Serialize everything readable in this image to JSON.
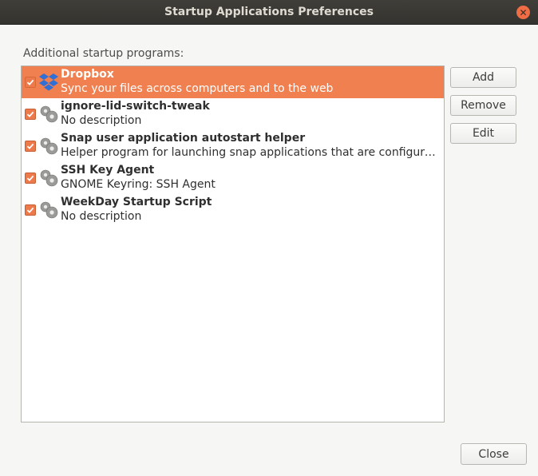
{
  "window": {
    "title": "Startup Applications Preferences"
  },
  "list_label": "Additional startup programs:",
  "programs": [
    {
      "name": "Dropbox",
      "description": "Sync your files across computers and to the web",
      "checked": true,
      "icon": "dropbox-icon",
      "selected": true
    },
    {
      "name": "ignore-lid-switch-tweak",
      "description": "No description",
      "checked": true,
      "icon": "gears-icon"
    },
    {
      "name": "Snap user application autostart helper",
      "description": "Helper program for launching snap applications that are configured t…",
      "checked": true,
      "icon": "gears-icon"
    },
    {
      "name": "SSH Key Agent",
      "description": "GNOME Keyring: SSH Agent",
      "checked": true,
      "icon": "gears-icon"
    },
    {
      "name": "WeekDay Startup Script",
      "description": "No description",
      "checked": true,
      "icon": "gears-icon"
    }
  ],
  "buttons": {
    "add": "Add",
    "remove": "Remove",
    "edit": "Edit",
    "close": "Close"
  },
  "colors": {
    "accent": "#f08050",
    "titlebar": "#3c3b37",
    "checkbox": "#ed7a4b",
    "dropbox": "#2f6fd6"
  }
}
